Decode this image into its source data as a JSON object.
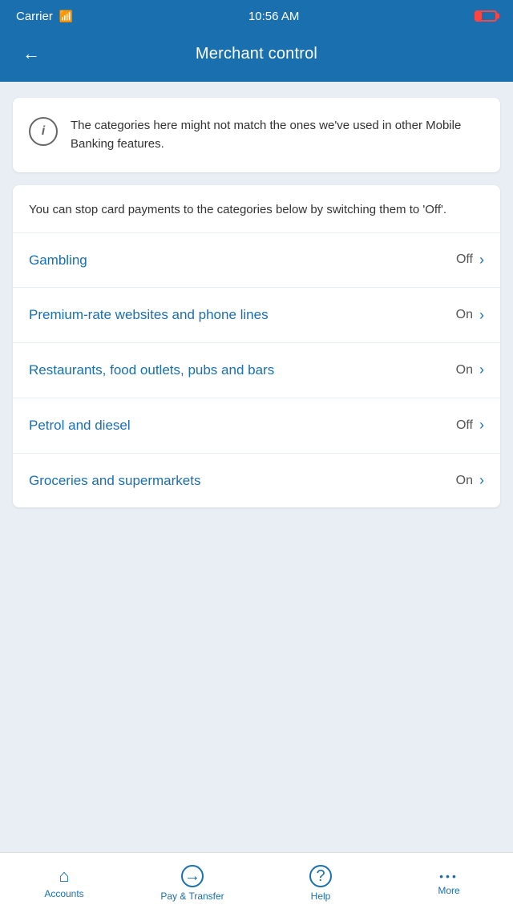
{
  "statusBar": {
    "carrier": "Carrier",
    "time": "10:56 AM"
  },
  "header": {
    "backLabel": "←",
    "title": "Merchant control"
  },
  "infoCard": {
    "iconLabel": "i",
    "text": "The categories here might not match the ones we've used in other Mobile Banking features."
  },
  "categorySection": {
    "intro": "You can stop card payments to the categories below by switching them to 'Off'.",
    "items": [
      {
        "id": "gambling",
        "name": "Gambling",
        "status": "Off"
      },
      {
        "id": "premium-rate",
        "name": "Premium-rate websites and phone lines",
        "status": "On"
      },
      {
        "id": "restaurants",
        "name": "Restaurants, food outlets, pubs and bars",
        "status": "On"
      },
      {
        "id": "petrol",
        "name": "Petrol and diesel",
        "status": "Off"
      },
      {
        "id": "groceries",
        "name": "Groceries and supermarkets",
        "status": "On"
      }
    ]
  },
  "bottomNav": {
    "items": [
      {
        "id": "accounts",
        "icon": "🏠",
        "label": "Accounts"
      },
      {
        "id": "pay-transfer",
        "icon": "⊙",
        "label": "Pay & Transfer"
      },
      {
        "id": "help",
        "icon": "?",
        "label": "Help"
      },
      {
        "id": "more",
        "icon": "···",
        "label": "More"
      }
    ]
  }
}
